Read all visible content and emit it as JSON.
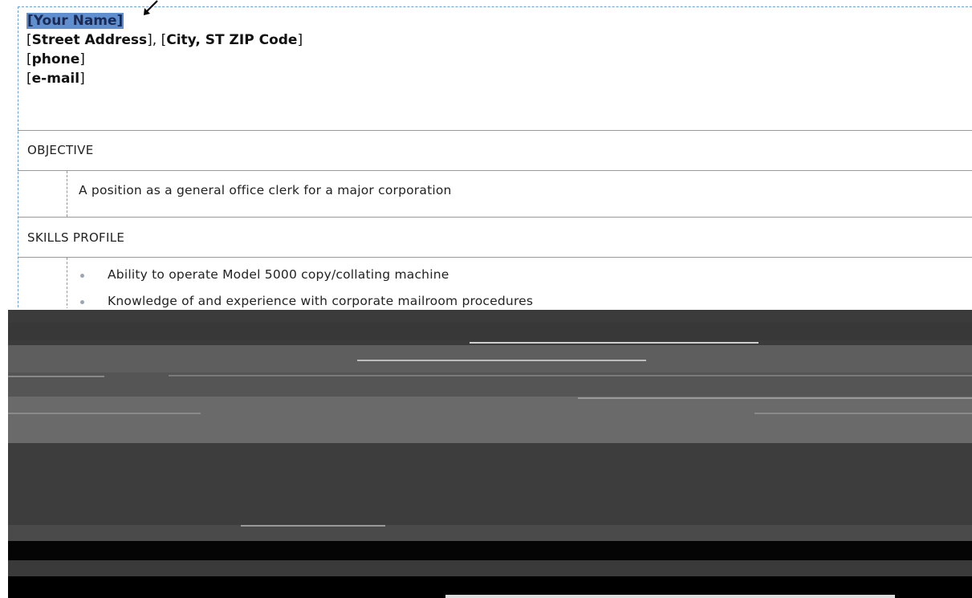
{
  "header": {
    "name": "[Your Name]",
    "address_prefix": "[",
    "street": "Street Address",
    "address_mid": "], [",
    "city": "City, ST  ZIP Code",
    "address_suffix": "]",
    "phone_open": "[",
    "phone": "phone",
    "phone_close": "]",
    "email_open": "[",
    "email": "e-mail",
    "email_close": "]"
  },
  "sections": {
    "objective": {
      "heading": "OBJECTIVE",
      "text": "A position as a general office clerk for a major corporation"
    },
    "skills": {
      "heading": "SKILLS PROFILE",
      "items": [
        "Ability to operate Model 5000 copy/collating machine",
        "Knowledge of and experience with corporate mailroom procedures"
      ]
    }
  },
  "colors": {
    "selection": "#5f8fcf",
    "table_border_dashed": "#6b9fd6",
    "rule": "#999999",
    "artifact_dark": "#3a3a3a",
    "artifact_mid": "#666666"
  },
  "icons": {
    "cursor": "arrow-cursor-icon",
    "bullet": "bullet-dot-icon"
  }
}
